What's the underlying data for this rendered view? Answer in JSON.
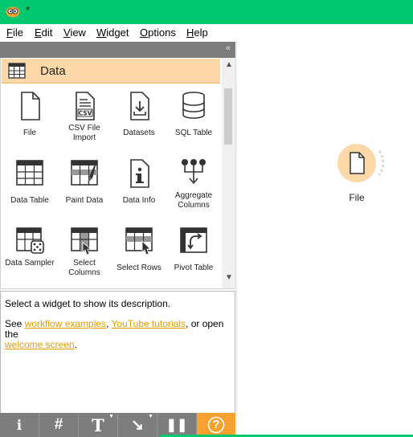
{
  "window": {
    "title": "*"
  },
  "menu": {
    "file": "File",
    "edit": "Edit",
    "view": "View",
    "widget": "Widget",
    "options": "Options",
    "help": "Help"
  },
  "toolbox": {
    "collapse_glyph": "«",
    "category": "Data",
    "widgets": [
      {
        "label": "File",
        "icon": "file-icon"
      },
      {
        "label": "CSV File Import",
        "icon": "csv-icon"
      },
      {
        "label": "Datasets",
        "icon": "datasets-icon"
      },
      {
        "label": "SQL Table",
        "icon": "database-icon"
      },
      {
        "label": "Data Table",
        "icon": "table-icon"
      },
      {
        "label": "Paint Data",
        "icon": "paint-icon"
      },
      {
        "label": "Data Info",
        "icon": "info-icon"
      },
      {
        "label": "Aggregate Columns",
        "icon": "aggregate-icon"
      },
      {
        "label": "Data Sampler",
        "icon": "sampler-icon"
      },
      {
        "label": "Select Columns",
        "icon": "select-columns-icon"
      },
      {
        "label": "Select Rows",
        "icon": "select-rows-icon"
      },
      {
        "label": "Pivot Table",
        "icon": "pivot-icon"
      }
    ]
  },
  "description": {
    "line1": "Select a widget to show its description.",
    "see": "See ",
    "link1": "workflow examples",
    "comma": ", ",
    "link2": "YouTube tutorials",
    "mid": ", or open the",
    "link3": "welcome screen",
    "end": "."
  },
  "bottom_toolbar": {
    "info": "i",
    "grid": "#",
    "text": "T",
    "arrow": "↘",
    "pause": "❚❚",
    "help": "?"
  },
  "canvas": {
    "node_label": "File"
  },
  "colors": {
    "accent": "#00c86e",
    "category_bg": "#fdd8a9",
    "node_ring": "#f7a230",
    "link": "#e39b00"
  }
}
